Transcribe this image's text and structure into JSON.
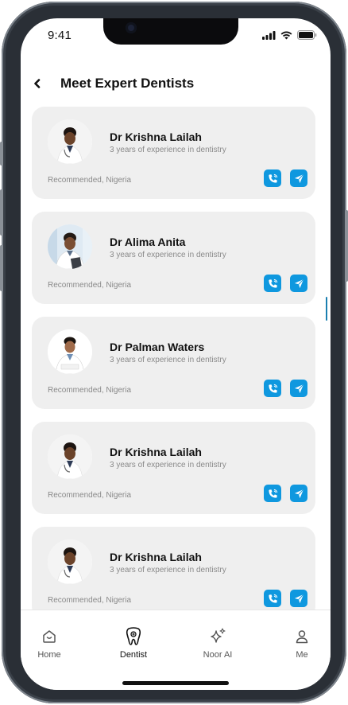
{
  "status_bar": {
    "time": "9:41"
  },
  "header": {
    "title": "Meet Expert Dentists"
  },
  "dentists": [
    {
      "name": "Dr Krishna Lailah",
      "experience": "3 years of experience in dentistry",
      "location": "Recommended, Nigeria"
    },
    {
      "name": "Dr Alima Anita",
      "experience": "3 years of experience in dentistry",
      "location": "Recommended, Nigeria"
    },
    {
      "name": "Dr Palman Waters",
      "experience": "3 years of experience in dentistry",
      "location": "Recommended, Nigeria"
    },
    {
      "name": "Dr Krishna Lailah",
      "experience": "3 years of experience in dentistry",
      "location": "Recommended, Nigeria"
    },
    {
      "name": "Dr Krishna Lailah",
      "experience": "3 years of experience in dentistry",
      "location": "Recommended, Nigeria"
    }
  ],
  "tabs": [
    {
      "label": "Home",
      "icon": "home-icon"
    },
    {
      "label": "Dentist",
      "icon": "tooth-icon",
      "active": true
    },
    {
      "label": "Noor AI",
      "icon": "sparkle-icon"
    },
    {
      "label": "Me",
      "icon": "user-icon"
    }
  ],
  "colors": {
    "accent": "#0f98df",
    "card_bg": "#efefef"
  }
}
